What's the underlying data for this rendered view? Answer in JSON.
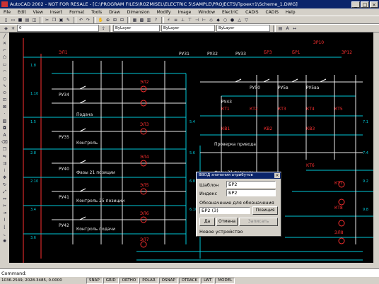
{
  "window": {
    "title": "AutoCAD 2002 - NOT FOR RESALE - [C:\\PROGRAM FILES\\ROZMISEL\\ELECTRIC 5\\SAMPLE\\PROJECTS\\Проект1\\Scheme_1.DWG]",
    "minimize": "_",
    "maximize": "□",
    "close": "×"
  },
  "menu": [
    "File",
    "Edit",
    "View",
    "Insert",
    "Format",
    "Tools",
    "Draw",
    "Dimension",
    "Modify",
    "Image",
    "Window",
    "ElectriC",
    "CADiS",
    "CADiS",
    "Help"
  ],
  "toolbar": {
    "layer": "0",
    "linetype": "ByLayer",
    "lineweight": "ByLayer",
    "color": "ByLayer"
  },
  "drawing": {
    "labels_red": [
      "БР2",
      "БР3",
      "БР1",
      "ЗР10",
      "ЗР12",
      "КТ1",
      "КТ2",
      "КТ3",
      "КТ4",
      "КТ5",
      "КТ6",
      "КТ7",
      "КТ8",
      "КВ1",
      "КВ2",
      "КВ3",
      "ЭЛ1",
      "ЭЛ2",
      "ЭЛ3",
      "ЭЛ4",
      "ЭЛ5",
      "ЭЛ6",
      "ЭЛ7",
      "ЭЛ8"
    ],
    "labels_white": [
      "РУ31",
      "РУ32",
      "РУ33",
      "РУ34",
      "РУ35",
      "РУ40",
      "РУ41",
      "РУ42",
      "РУ43",
      "РУ50",
      "РУ5в",
      "РУ5ва",
      "Подача",
      "Контроль",
      "Фазы 21 позиции",
      "Контроль 25 позиции",
      "Проверка привода",
      "Фазы 21 позиции",
      "Контроль подачи"
    ],
    "labels_cyan": [
      "1.8",
      "1.10",
      "1.5",
      "2.8",
      "2.10",
      "3.4",
      "3.6",
      "5.4",
      "5.6",
      "6.8",
      "6.10",
      "7.1",
      "7.4",
      "9.2",
      "9.8"
    ]
  },
  "dialog": {
    "title": "ВВОД значения атрибутов",
    "close": "×",
    "name_label": "Шаблон",
    "name_value": "БР2",
    "index_label": "Индекс",
    "index_value": "БР2",
    "designation_label": "Обозначение для обозначения",
    "designation_value": "БР2 (3)",
    "designation_btn": "Позиция",
    "ok": "Да",
    "cancel": "Отмена",
    "apply": "Записать",
    "footer": "Новое устройство"
  },
  "command": {
    "prompt": "Command:"
  },
  "status": {
    "coords": "1036.2549, 2028.3485, 0.0000",
    "modes": [
      "SNAP",
      "GRID",
      "ORTHO",
      "POLAR",
      "OSNAP",
      "OTRACK",
      "LWT",
      "MODEL"
    ]
  }
}
